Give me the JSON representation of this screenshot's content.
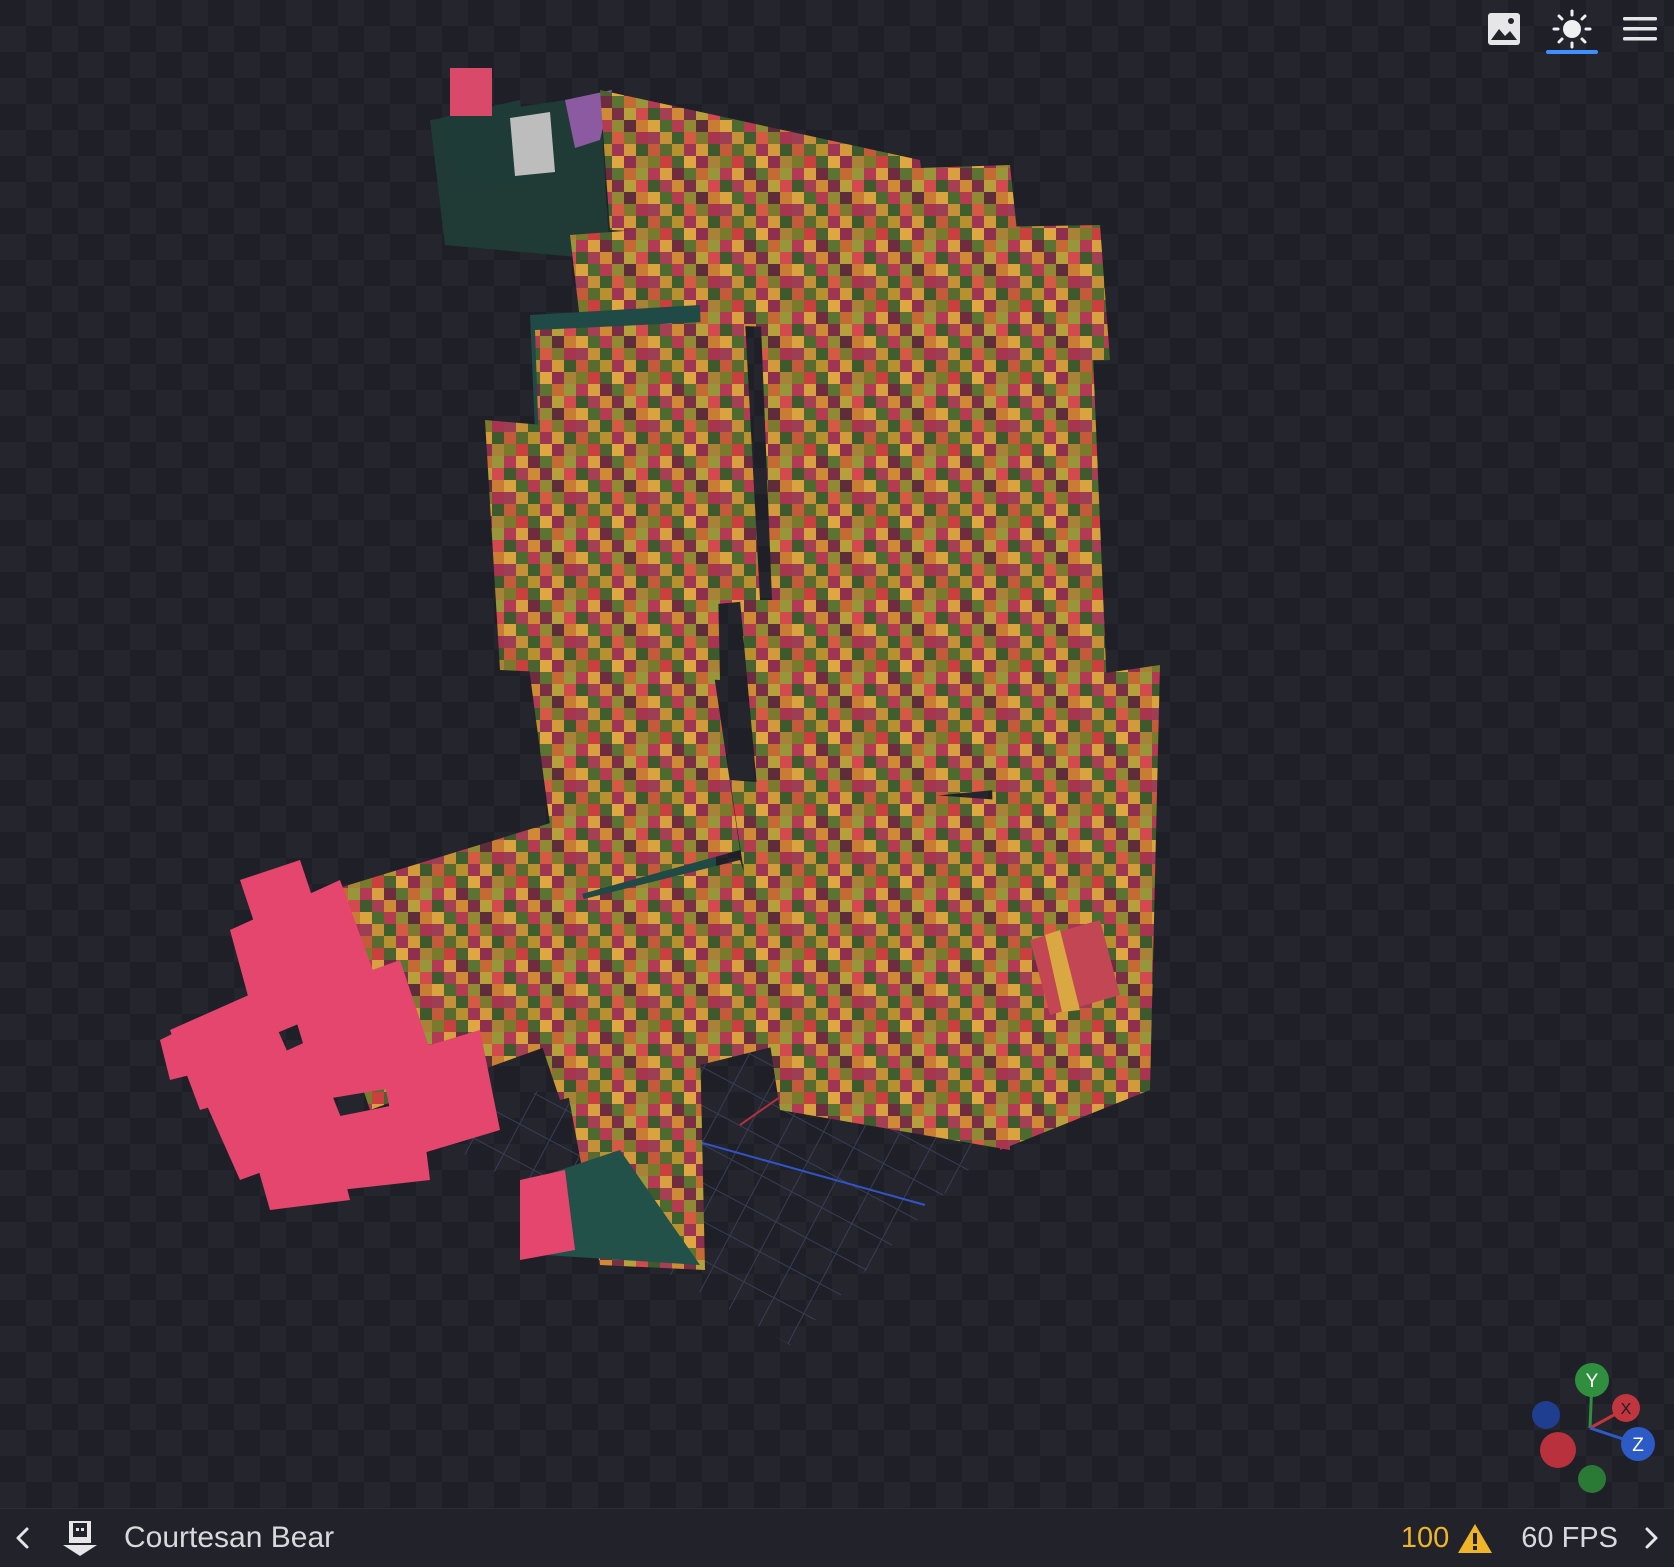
{
  "toolbar": {
    "icons": [
      "image-icon",
      "sun-icon",
      "menu-icon"
    ],
    "active": "sun-icon"
  },
  "statusbar": {
    "model_name": "Courtesan Bear",
    "warning_count": "100",
    "fps": "60 FPS"
  },
  "gizmo": {
    "y": "Y",
    "x": "X",
    "z": "Z"
  },
  "colors": {
    "accent": "#3e90ff",
    "warning": "#f0b429",
    "axis_x": "#c0353e",
    "axis_y": "#2f8f3e",
    "axis_z": "#2c5bc6"
  }
}
